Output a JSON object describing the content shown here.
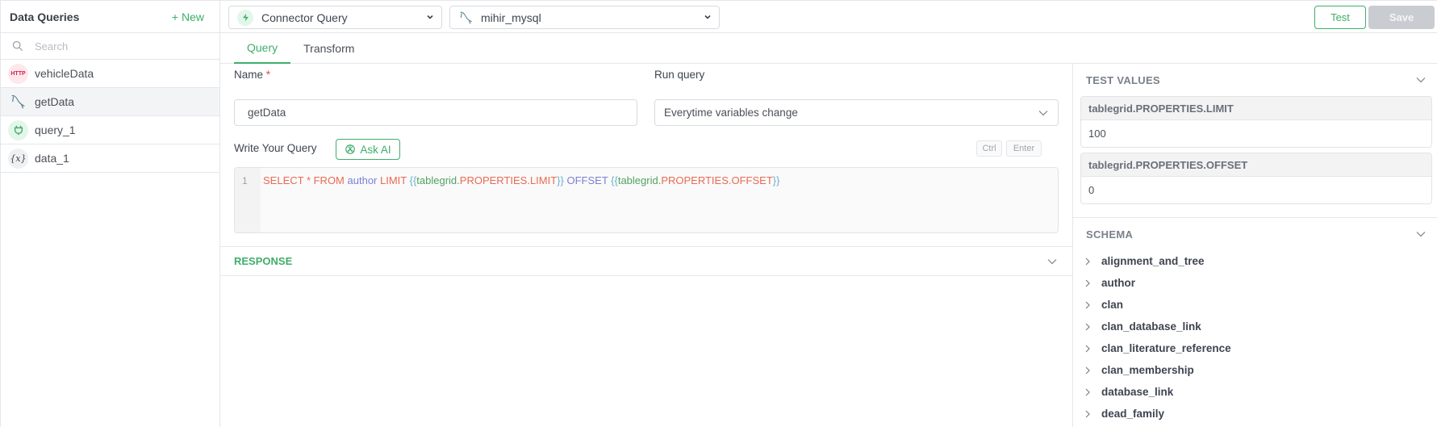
{
  "sidebar": {
    "title": "Data Queries",
    "new_label": "+ New",
    "search_placeholder": "Search",
    "items": [
      {
        "label": "vehicleData",
        "icon": "http-icon",
        "icon_text": "HTTP",
        "active": false
      },
      {
        "label": "getData",
        "icon": "mysql-icon",
        "active": true
      },
      {
        "label": "query_1",
        "icon": "plug-icon",
        "active": false
      },
      {
        "label": "data_1",
        "icon": "variable-icon",
        "icon_text": "{x}",
        "active": false
      }
    ]
  },
  "topbar": {
    "kind_select": "Connector Query",
    "source_select": "mihir_mysql",
    "test_label": "Test",
    "save_label": "Save"
  },
  "tabs": [
    {
      "label": "Query",
      "active": true
    },
    {
      "label": "Transform",
      "active": false
    }
  ],
  "editor": {
    "name_label": "Name",
    "name_required": "*",
    "name_value": "getData",
    "run_query_label": "Run query",
    "run_query_value": "Everytime variables change",
    "write_query_label": "Write Your Query",
    "ask_ai_label": "Ask AI",
    "shortcut_keys": [
      "Ctrl",
      "Enter"
    ],
    "line_number": "1",
    "query_tokens": {
      "select": "SELECT * FROM ",
      "table": "author ",
      "limit": "LIMIT ",
      "open1": "{{",
      "ns1": "tablegrid.",
      "prop1": "PROPERTIES.LIMIT",
      "close1": "}} ",
      "offset": "OFFSET ",
      "open2": "{{",
      "ns2": "tablegrid.",
      "prop2": "PROPERTIES.OFFSET",
      "close2": "}}"
    },
    "query_text": "SELECT * FROM author LIMIT {{tablegrid.PROPERTIES.LIMIT}} OFFSET {{tablegrid.PROPERTIES.OFFSET}}",
    "response_label": "RESPONSE"
  },
  "right_panel": {
    "test_values_title": "TEST VALUES",
    "test_values": [
      {
        "key": "tablegrid.PROPERTIES.LIMIT",
        "value": "100"
      },
      {
        "key": "tablegrid.PROPERTIES.OFFSET",
        "value": "0"
      }
    ],
    "schema_title": "SCHEMA",
    "schema_tables": [
      "alignment_and_tree",
      "author",
      "clan",
      "clan_database_link",
      "clan_literature_reference",
      "clan_membership",
      "database_link",
      "dead_family"
    ]
  },
  "colors": {
    "accent": "#3fae6c",
    "required": "#e5484d",
    "save_disabled": "#c9ccd1"
  }
}
